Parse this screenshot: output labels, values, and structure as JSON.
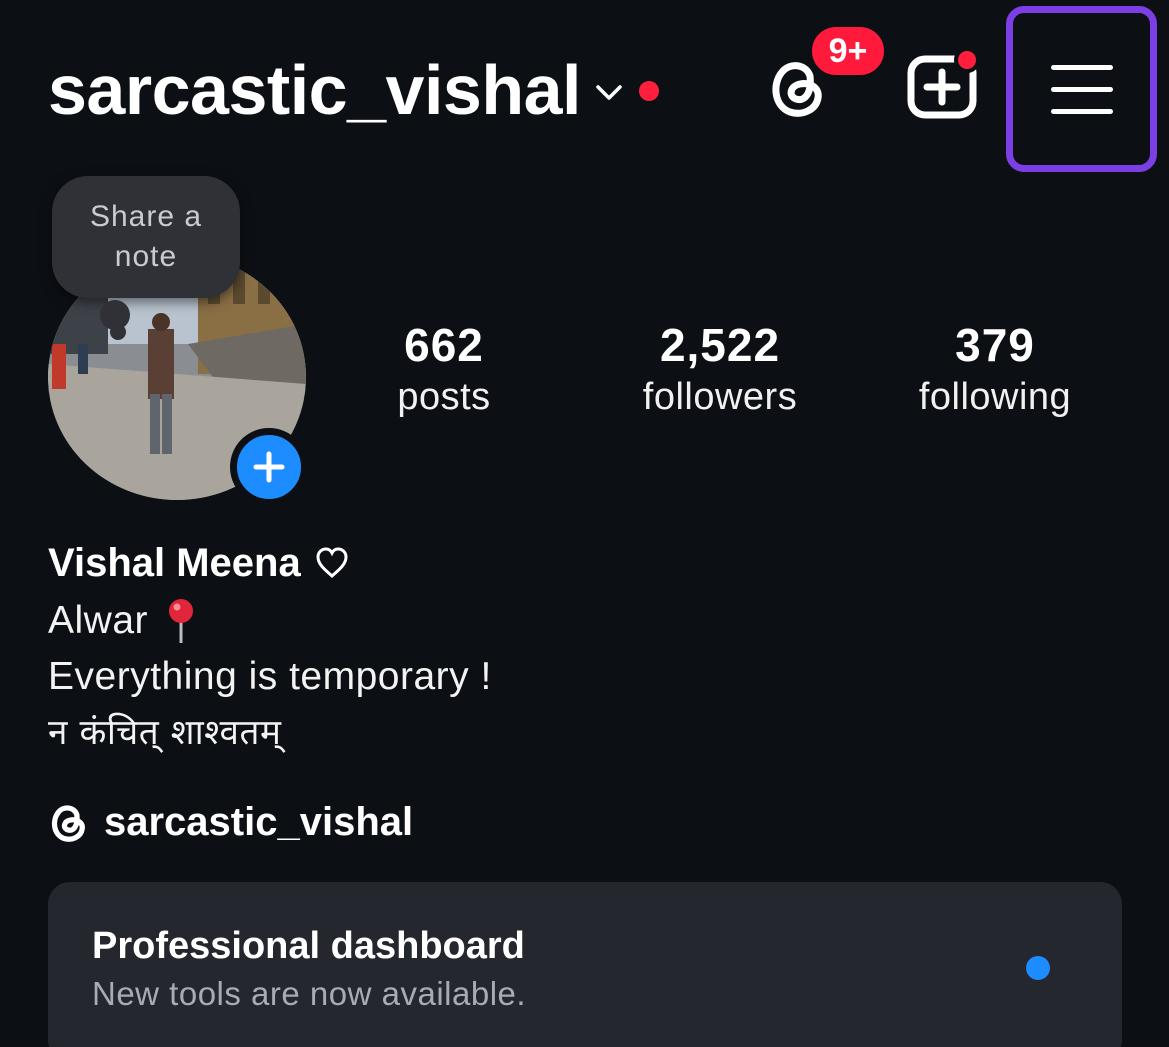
{
  "header": {
    "username": "sarcastic_vishal",
    "threads_badge": "9+",
    "accent_red": "#ff1f3d",
    "menu_highlight_color": "#7b3fe4"
  },
  "note": {
    "prompt": "Share a note"
  },
  "stats": {
    "posts_count": "662",
    "posts_label": "posts",
    "followers_count": "2,522",
    "followers_label": "followers",
    "following_count": "379",
    "following_label": "following"
  },
  "bio": {
    "full_name": "Vishal Meena",
    "line1": "Alwar",
    "line2": "Everything is temporary !",
    "line3": "न कंचित् शाश्वतम्"
  },
  "threads_link": {
    "handle": "sarcastic_vishal"
  },
  "dashboard": {
    "title": "Professional dashboard",
    "subtitle": "New tools are now available.",
    "accent_blue": "#1d8cff"
  },
  "icons": [
    "chevron-down-icon",
    "threads-icon",
    "create-icon",
    "menu-icon",
    "plus-icon",
    "heart-icon",
    "pin-icon"
  ]
}
